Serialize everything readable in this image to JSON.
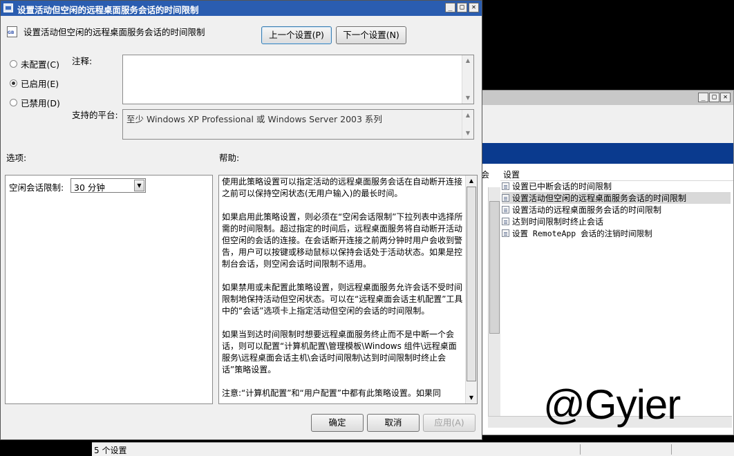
{
  "dialog": {
    "title": "设置活动但空闲的远程桌面服务会话的时间限制",
    "header": "设置活动但空闲的远程桌面服务会话的时间限制",
    "prev_button": "上一个设置(P)",
    "next_button": "下一个设置(N)",
    "radio_not_configured": "未配置(C)",
    "radio_enabled": "已启用(E)",
    "radio_disabled": "已禁用(D)",
    "comment_label": "注释:",
    "platform_label": "支持的平台:",
    "platform_value": "至少 Windows XP Professional 或 Windows Server 2003 系列",
    "options_label": "选项:",
    "help_label": "帮助:",
    "idle_limit_label": "空闲会话限制:",
    "idle_limit_value": "30 分钟",
    "help_paragraphs": [
      "使用此策略设置可以指定活动的远程桌面服务会话在自动断开连接之前可以保持空闲状态(无用户输入)的最长时间。",
      "如果启用此策略设置，则必须在“空闲会话限制”下拉列表中选择所需的时间限制。超过指定的时间后，远程桌面服务将自动断开活动但空闲的会话的连接。在会话断开连接之前两分钟时用户会收到警告，用户可以按键或移动鼠标以保持会话处于活动状态。如果是控制台会话，则空闲会话时间限制不适用。",
      "如果禁用或未配置此策略设置，则远程桌面服务允许会话不受时间限制地保持活动但空闲状态。可以在“远程桌面会话主机配置”工具中的“会话”选项卡上指定活动但空闲的会话的时间限制。",
      "如果当到达时间限制时想要远程桌面服务终止而不是中断一个会话，则可以配置“计算机配置\\管理模板\\Windows 组件\\远程桌面服务\\远程桌面会话主机\\会话时间限制\\达到时间限制时终止会话”策略设置。",
      "注意:“计算机配置”和“用户配置”中都有此策略设置。如果同"
    ],
    "ok_button": "确定",
    "cancel_button": "取消",
    "apply_button": "应用(A)"
  },
  "background": {
    "column_header": "设置",
    "column_header_left": "会",
    "policies": [
      "设置已中断会话的时间限制",
      "设置活动但空闲的远程桌面服务会话的时间限制",
      "设置活动的远程桌面服务会话的时间限制",
      "达到时间限制时终止会话",
      "设置 RemoteApp 会话的注销时间限制"
    ],
    "status": "5 个设置",
    "watermark": "@Gyier"
  }
}
